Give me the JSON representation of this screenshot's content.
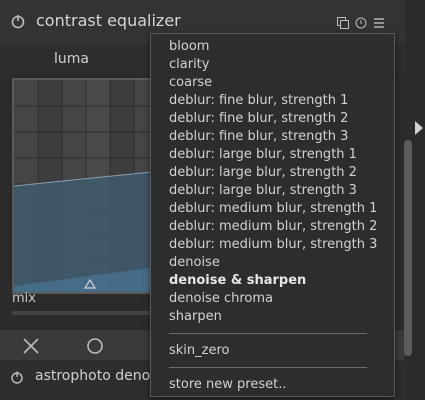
{
  "module": {
    "title": "contrast equalizer",
    "tab": "luma",
    "mix_label": "mix"
  },
  "next_module": {
    "title": "astrophoto denoise"
  },
  "presets_menu": {
    "items": [
      "bloom",
      "clarity",
      "coarse",
      "deblur: fine blur, strength 1",
      "deblur: fine blur, strength 2",
      "deblur: fine blur, strength 3",
      "deblur: large blur, strength 1",
      "deblur: large blur, strength 2",
      "deblur: large blur, strength 3",
      "deblur: medium blur, strength 1",
      "deblur: medium blur, strength 2",
      "deblur: medium blur, strength 3",
      "denoise",
      "denoise & sharpen",
      "denoise chroma",
      "sharpen"
    ],
    "selected": "denoise & sharpen",
    "user_presets": [
      "skin_zero"
    ],
    "store_new": "store new preset.."
  },
  "icons": {
    "power": "power-icon",
    "multi_instance": "multi-instance-icon",
    "reset": "reset-icon",
    "presets": "presets-menu-icon",
    "graph_node": "graph-node-marker-icon",
    "toolbar_close": "close-x-icon",
    "toolbar_circle": "circle-icon",
    "scroll_arrow": "chevron-right-icon"
  },
  "colors": {
    "background": "#2b2b2b",
    "header": "#333333",
    "popup": "#2d2d2d",
    "text": "#d2d2d2",
    "graph_fill": "#3f5a6e"
  }
}
